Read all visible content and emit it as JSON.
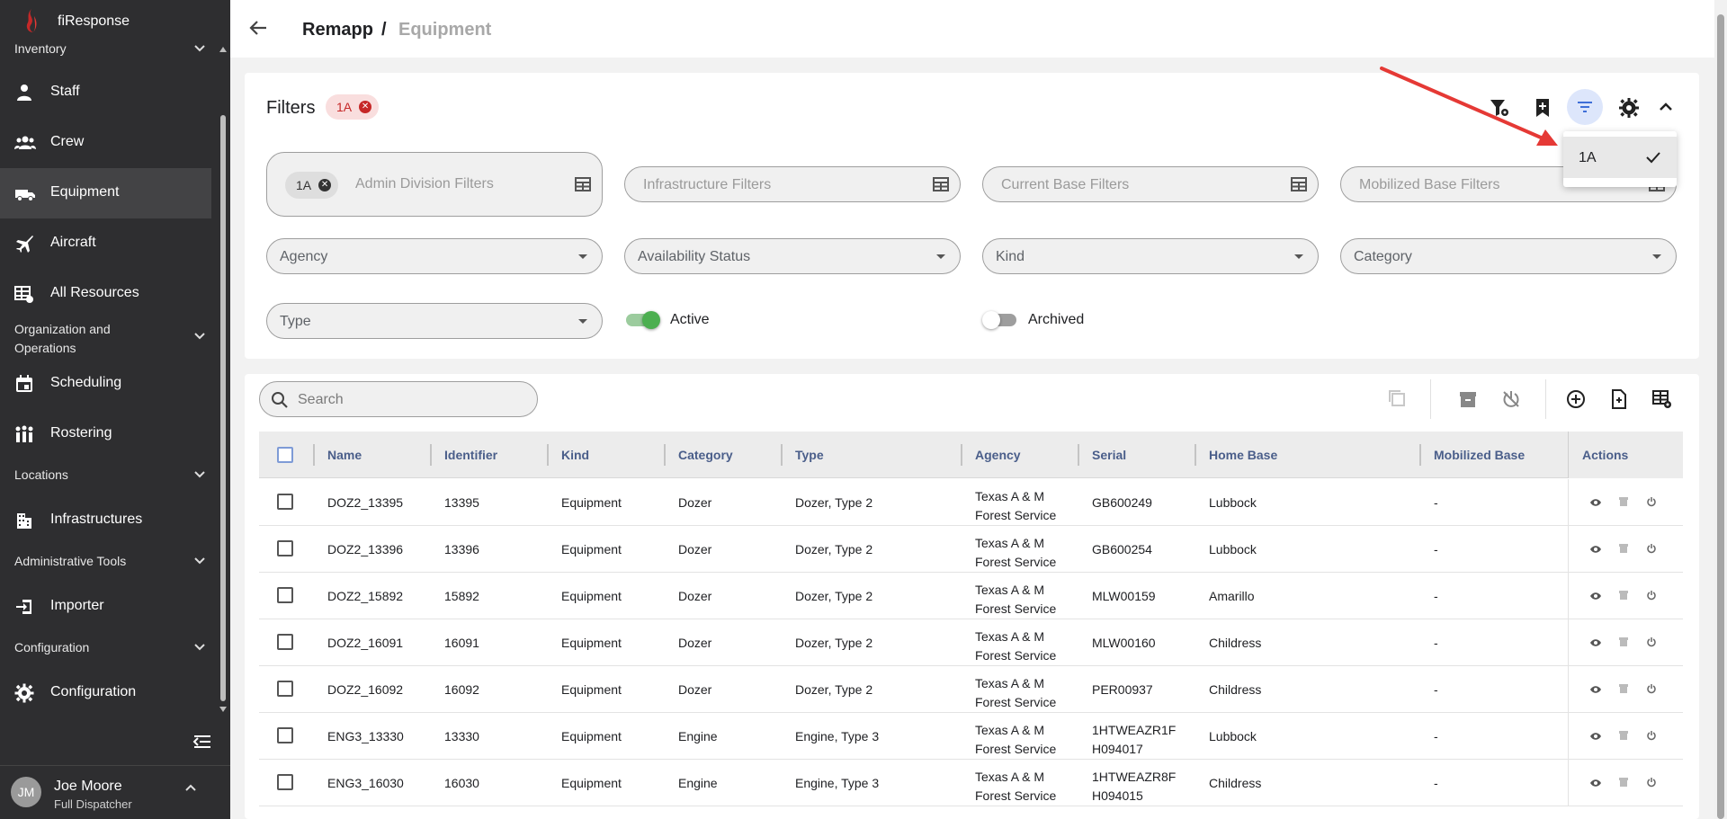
{
  "app": {
    "name": "fiResponse"
  },
  "sidebar": {
    "sections": [
      {
        "label": "Inventory"
      },
      {
        "label": "Organization and Operations"
      },
      {
        "label": "Locations"
      },
      {
        "label": "Administrative Tools"
      },
      {
        "label": "Configuration"
      }
    ],
    "items": [
      {
        "label": "Staff",
        "icon": "staff-icon"
      },
      {
        "label": "Crew",
        "icon": "crew-icon"
      },
      {
        "label": "Equipment",
        "icon": "truck-icon",
        "active": true
      },
      {
        "label": "Aircraft",
        "icon": "airplane-icon"
      },
      {
        "label": "All Resources",
        "icon": "resources-icon"
      },
      {
        "label": "Scheduling",
        "icon": "calendar-icon"
      },
      {
        "label": "Rostering",
        "icon": "people-icon"
      },
      {
        "label": "Infrastructures",
        "icon": "building-icon"
      },
      {
        "label": "Importer",
        "icon": "import-icon"
      },
      {
        "label": "Configuration",
        "icon": "gear-icon"
      }
    ],
    "user": {
      "initials": "JM",
      "name": "Joe Moore",
      "role": "Full Dispatcher"
    }
  },
  "breadcrumb": {
    "parent": "Remapp",
    "separator": "/",
    "current": "Equipment"
  },
  "filters": {
    "title": "Filters",
    "active_chip": "1A",
    "admin_division": {
      "chip": "1A",
      "placeholder": "Admin Division Filters"
    },
    "infrastructure": {
      "placeholder": "Infrastructure Filters"
    },
    "current_base": {
      "placeholder": "Current Base Filters"
    },
    "mobilized_base": {
      "placeholder": "Mobilized Base Filters"
    },
    "agency": {
      "placeholder": "Agency"
    },
    "availability": {
      "placeholder": "Availability Status"
    },
    "kind": {
      "placeholder": "Kind"
    },
    "category": {
      "placeholder": "Category"
    },
    "type": {
      "placeholder": "Type"
    },
    "active_toggle": {
      "label": "Active",
      "on": true
    },
    "archived_toggle": {
      "label": "Archived",
      "on": false
    },
    "saved_filters_menu": {
      "option": "1A",
      "selected": true
    }
  },
  "colors": {
    "accent": "#4caf50",
    "chip_red": "#c62828",
    "header_text": "#4a5e8a",
    "annotation_arrow": "#e53935"
  },
  "table": {
    "search_placeholder": "Search",
    "columns": [
      "Name",
      "Identifier",
      "Kind",
      "Category",
      "Type",
      "Agency",
      "Serial",
      "Home Base",
      "Mobilized Base",
      "Actions"
    ],
    "rows": [
      {
        "name": "DOZ2_13395",
        "identifier": "13395",
        "kind": "Equipment",
        "category": "Dozer",
        "type": "Dozer, Type 2",
        "agency_l1": "Texas A & M",
        "agency_l2": "Forest Service",
        "serial_l1": "GB600249",
        "serial_l2": "",
        "home_base": "Lubbock",
        "mobilized_base": "-"
      },
      {
        "name": "DOZ2_13396",
        "identifier": "13396",
        "kind": "Equipment",
        "category": "Dozer",
        "type": "Dozer, Type 2",
        "agency_l1": "Texas A & M",
        "agency_l2": "Forest Service",
        "serial_l1": "GB600254",
        "serial_l2": "",
        "home_base": "Lubbock",
        "mobilized_base": "-"
      },
      {
        "name": "DOZ2_15892",
        "identifier": "15892",
        "kind": "Equipment",
        "category": "Dozer",
        "type": "Dozer, Type 2",
        "agency_l1": "Texas A & M",
        "agency_l2": "Forest Service",
        "serial_l1": "MLW00159",
        "serial_l2": "",
        "home_base": "Amarillo",
        "mobilized_base": "-"
      },
      {
        "name": "DOZ2_16091",
        "identifier": "16091",
        "kind": "Equipment",
        "category": "Dozer",
        "type": "Dozer, Type 2",
        "agency_l1": "Texas A & M",
        "agency_l2": "Forest Service",
        "serial_l1": "MLW00160",
        "serial_l2": "",
        "home_base": "Childress",
        "mobilized_base": "-"
      },
      {
        "name": "DOZ2_16092",
        "identifier": "16092",
        "kind": "Equipment",
        "category": "Dozer",
        "type": "Dozer, Type 2",
        "agency_l1": "Texas A & M",
        "agency_l2": "Forest Service",
        "serial_l1": "PER00937",
        "serial_l2": "",
        "home_base": "Childress",
        "mobilized_base": "-"
      },
      {
        "name": "ENG3_13330",
        "identifier": "13330",
        "kind": "Equipment",
        "category": "Engine",
        "type": "Engine, Type 3",
        "agency_l1": "Texas A & M",
        "agency_l2": "Forest Service",
        "serial_l1": "1HTWEAZR1F",
        "serial_l2": "H094017",
        "home_base": "Lubbock",
        "mobilized_base": "-"
      },
      {
        "name": "ENG3_16030",
        "identifier": "16030",
        "kind": "Equipment",
        "category": "Engine",
        "type": "Engine, Type 3",
        "agency_l1": "Texas A & M",
        "agency_l2": "Forest Service",
        "serial_l1": "1HTWEAZR8F",
        "serial_l2": "H094015",
        "home_base": "Childress",
        "mobilized_base": "-"
      }
    ]
  }
}
